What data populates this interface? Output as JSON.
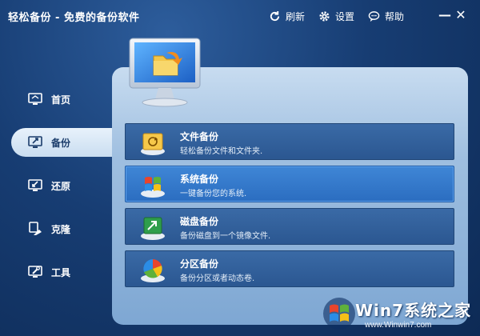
{
  "window": {
    "title": "轻松备份 - 免费的备份软件"
  },
  "toolbar": {
    "refresh_label": "刷新",
    "settings_label": "设置",
    "help_label": "帮助",
    "minimize_label": "—",
    "close_label": "✕"
  },
  "sidebar": {
    "items": [
      {
        "label": "首页",
        "icon": "home-monitor-icon",
        "active": false
      },
      {
        "label": "备份",
        "icon": "backup-monitor-icon",
        "active": true
      },
      {
        "label": "还原",
        "icon": "restore-monitor-icon",
        "active": false
      },
      {
        "label": "克隆",
        "icon": "clone-icon",
        "active": false
      },
      {
        "label": "工具",
        "icon": "tools-icon",
        "active": false
      }
    ]
  },
  "actions": [
    {
      "title": "文件备份",
      "desc": "轻松备份文件和文件夹.",
      "icon": "file-backup-icon",
      "selected": false
    },
    {
      "title": "系统备份",
      "desc": "一键备份您的系统.",
      "icon": "system-backup-icon",
      "selected": true
    },
    {
      "title": "磁盘备份",
      "desc": "备份磁盘到一个镜像文件.",
      "icon": "disk-backup-icon",
      "selected": false
    },
    {
      "title": "分区备份",
      "desc": "备份分区或者动态卷.",
      "icon": "partition-backup-icon",
      "selected": false
    }
  ],
  "watermark": {
    "brand": "Win7系统之家",
    "url": "www.Winwin7.com"
  },
  "colors": {
    "background": "#173d73",
    "panel": "#9fbfe0",
    "row": "#2b5791",
    "row_selected": "#2b6dc0"
  }
}
